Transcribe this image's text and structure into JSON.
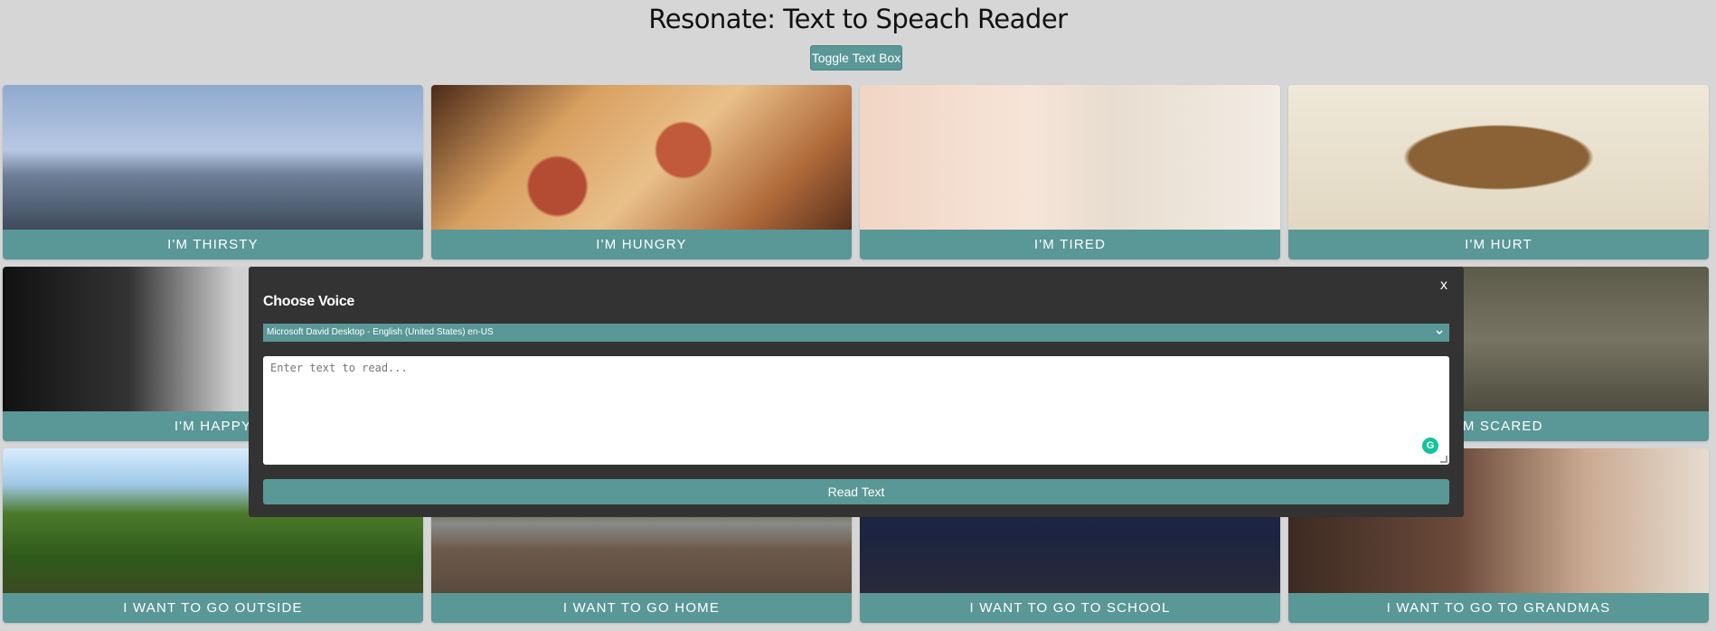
{
  "header": {
    "title": "Resonate: Text to Speach Reader"
  },
  "toolbar": {
    "toggle_label": "Toggle Text Box"
  },
  "cards": [
    {
      "label": "I'M THIRSTY"
    },
    {
      "label": "I'M HUNGRY"
    },
    {
      "label": "I'M TIRED"
    },
    {
      "label": "I'M HURT"
    },
    {
      "label": "I'M HAPPY"
    },
    {
      "label": "I'M SCARED"
    },
    {
      "label": "I WANT TO GO OUTSIDE"
    },
    {
      "label": "I WANT TO GO HOME"
    },
    {
      "label": "I WANT TO GO TO SCHOOL"
    },
    {
      "label": "I WANT TO GO TO GRANDMAS"
    }
  ],
  "panel": {
    "close_label": "x",
    "choose_voice_label": "Choose Voice",
    "selected_voice": "Microsoft David Desktop - English (United States) en-US",
    "text_placeholder": "Enter text to read...",
    "read_button_label": "Read Text",
    "grammarly_glyph": "G"
  },
  "colors": {
    "accent": "#5a9797",
    "panel_bg": "#333333",
    "page_bg": "#d6d6d6"
  }
}
